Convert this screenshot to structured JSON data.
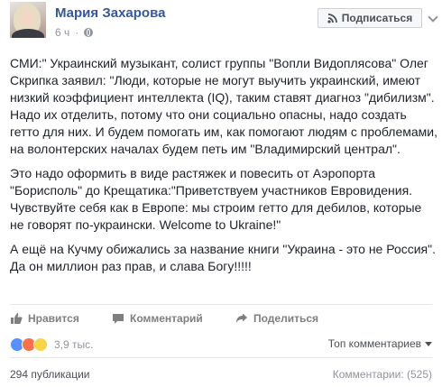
{
  "post": {
    "author": "Мария Захарова",
    "time": "6 ч",
    "subscribe_label": "Подписаться",
    "paragraphs": [
      "СМИ:\" Украинский музыкант, солист группы \"Вопли Видоплясова\" Олег Скрипка заявил: \"Люди, которые не могут выучить украинский, имеют низкий коэффициент интеллекта (IQ), таким ставят диагноз \"дибилизм\". Надо их отделить, потому что они социально опасны, надо создать гетто для них. И будем помогать им, как помогают людям с проблемами, на волонтерских началах будем петь им \"Владимирский централ\".",
      "Это надо оформить в виде растяжек и повесить от Аэропорта \"Борисполь\" до Крещатика:\"Приветствуем участников Евровидения. Чувствуйте себя как в Европе: мы строим гетто для дебилов, которые не говорят по-украински. Welcome to Ukraine!\"",
      "А ещё на Кучму обижались за название книги \"Украина - это не Россия\". Да он миллион раз прав, и слава Богу!!!!!"
    ]
  },
  "actions": {
    "like": "Нравится",
    "comment": "Комментарий",
    "share": "Поделиться"
  },
  "reactions": {
    "count": "3,9 тыс.",
    "types": [
      "like",
      "angry",
      "haha"
    ],
    "sort_label": "Топ комментариев"
  },
  "footer": {
    "shares": "294 публикации",
    "comments": "Комментарии: (525)"
  },
  "colors": {
    "author": "#365899",
    "like": "#5890ff",
    "angry": "#f7714c",
    "haha": "#f7d448"
  }
}
